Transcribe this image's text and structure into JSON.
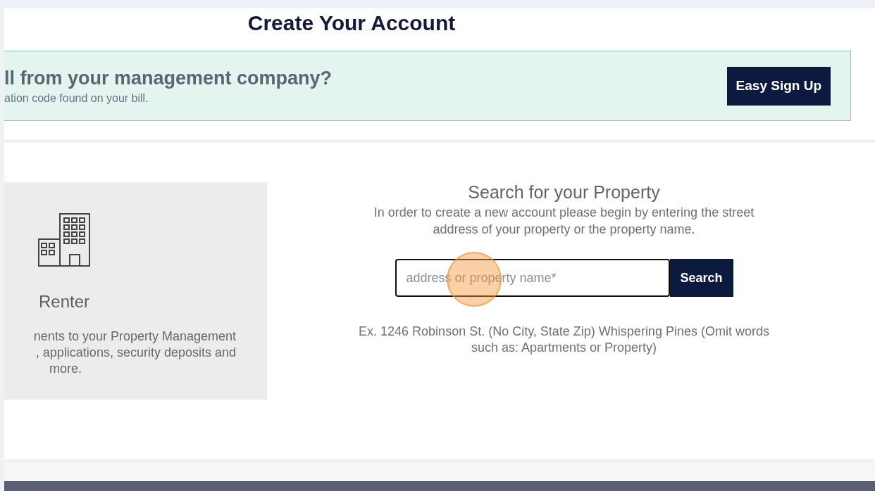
{
  "page": {
    "title": "Create Your Account"
  },
  "banner": {
    "heading": "ll from your management company?",
    "subtext": "ation code found on your bill.",
    "button": "Easy Sign Up"
  },
  "renter_card": {
    "title": "Renter",
    "description_lines": [
      "nents to your Property Management",
      ", applications, security deposits and",
      "more."
    ]
  },
  "property_search": {
    "title": "Search for your Property",
    "intro": "In order to create a new account please begin by entering the street address of your property or the property name.",
    "placeholder": "address or property name*",
    "button": "Search",
    "example": "Ex. 1246 Robinson St. (No City, State Zip) Whispering Pines (Omit words such as: Apartments or Property)",
    "click_highlight": true
  }
}
